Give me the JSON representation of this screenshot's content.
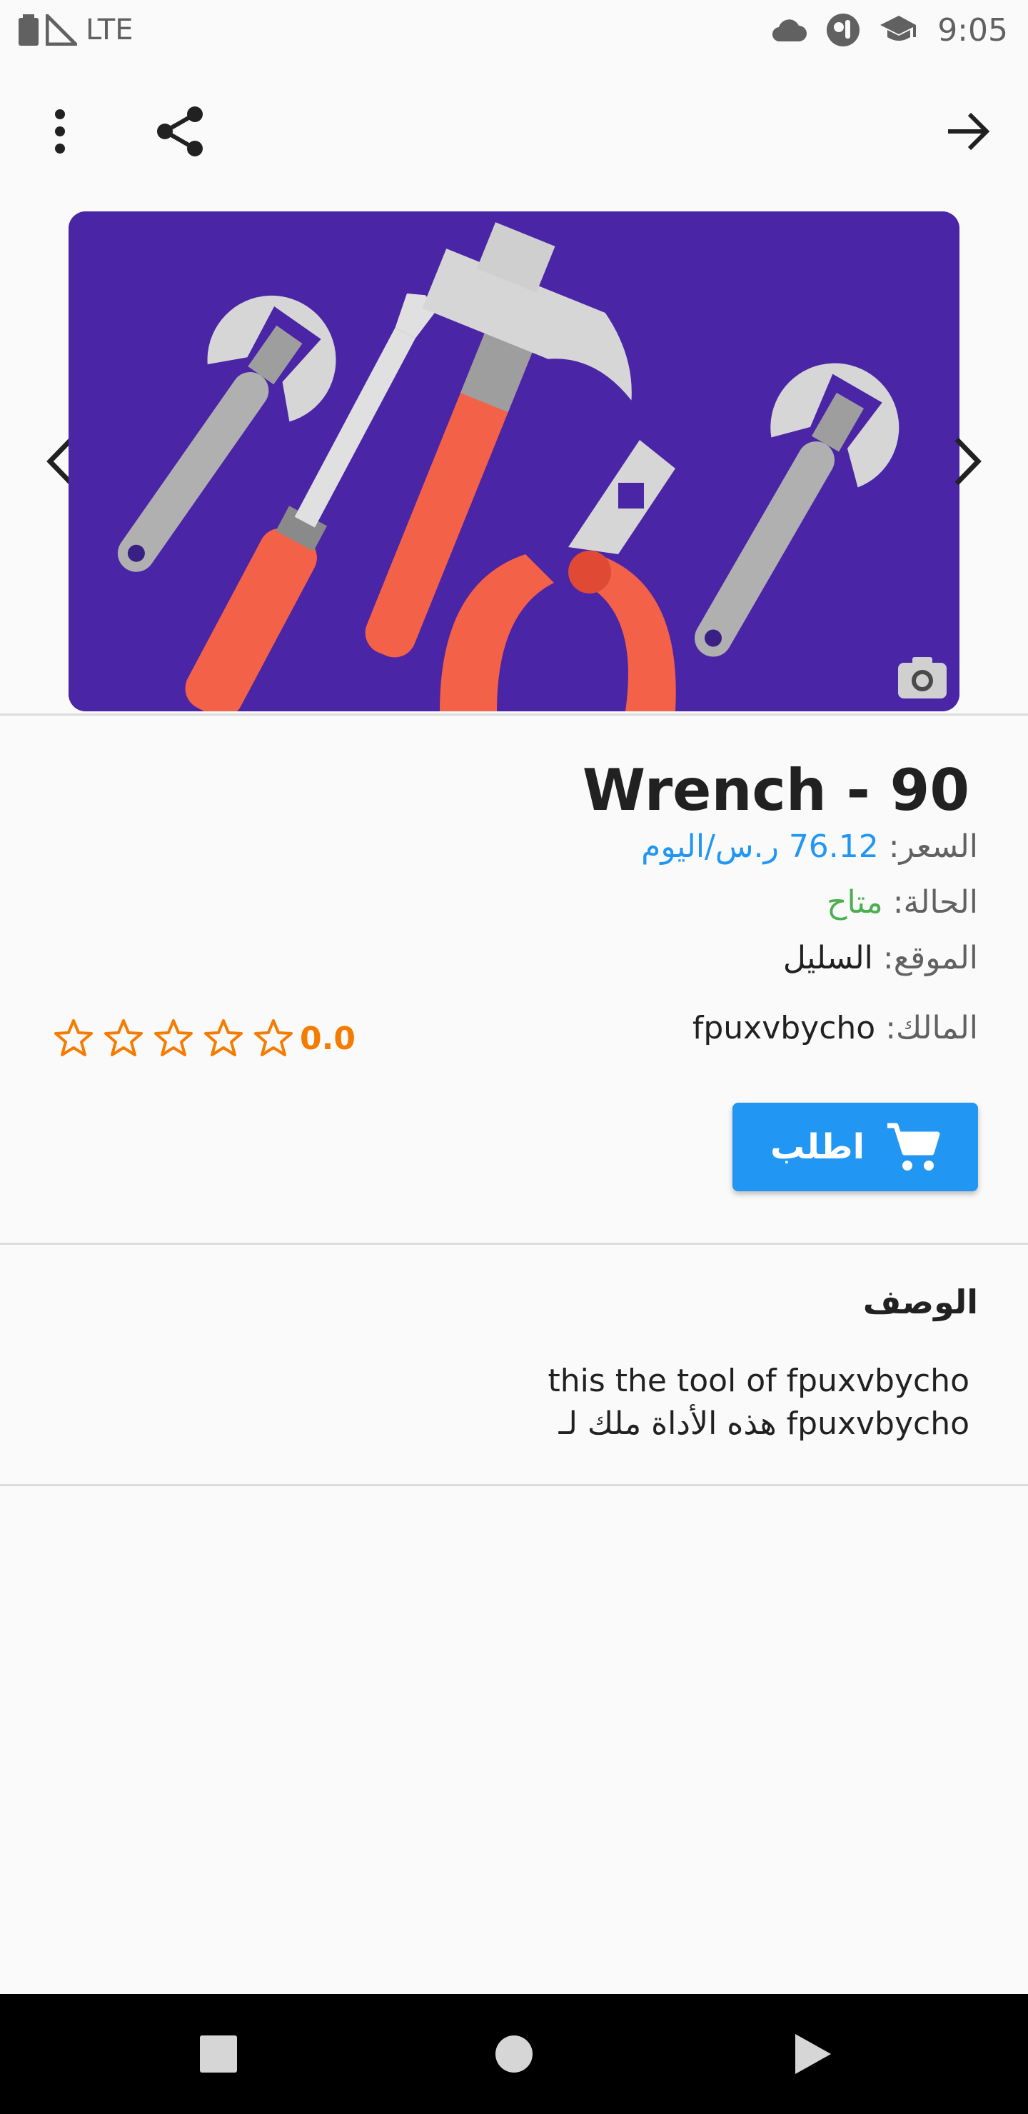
{
  "status_bar": {
    "network": "LTE",
    "time": "9:05"
  },
  "app_bar": {
    "icons": [
      "more-vert-icon",
      "share-icon",
      "arrow-forward-icon"
    ]
  },
  "tool": {
    "title": "Wrench - 90",
    "price_label": "السعر:",
    "price_value": "76.12 ر.س/اليوم",
    "status_label": "الحالة:",
    "status_value": "متاح",
    "location_label": "الموقع:",
    "location_value": "السليل",
    "owner_label": "المالك:",
    "owner_value": "fpuxvbycho",
    "rating": "0.0",
    "rating_stars_filled": 0,
    "rating_stars_total": 5
  },
  "order_button": {
    "label": "اطلب"
  },
  "description": {
    "heading": "الوصف",
    "text": "this the tool of fpuxvbycho\nهذه الأداة ملك لـ fpuxvbycho"
  },
  "colors": {
    "accent": "#2196f3",
    "available": "#4caf50",
    "rating": "#f57c00",
    "hero_background": "#4a25a6"
  }
}
